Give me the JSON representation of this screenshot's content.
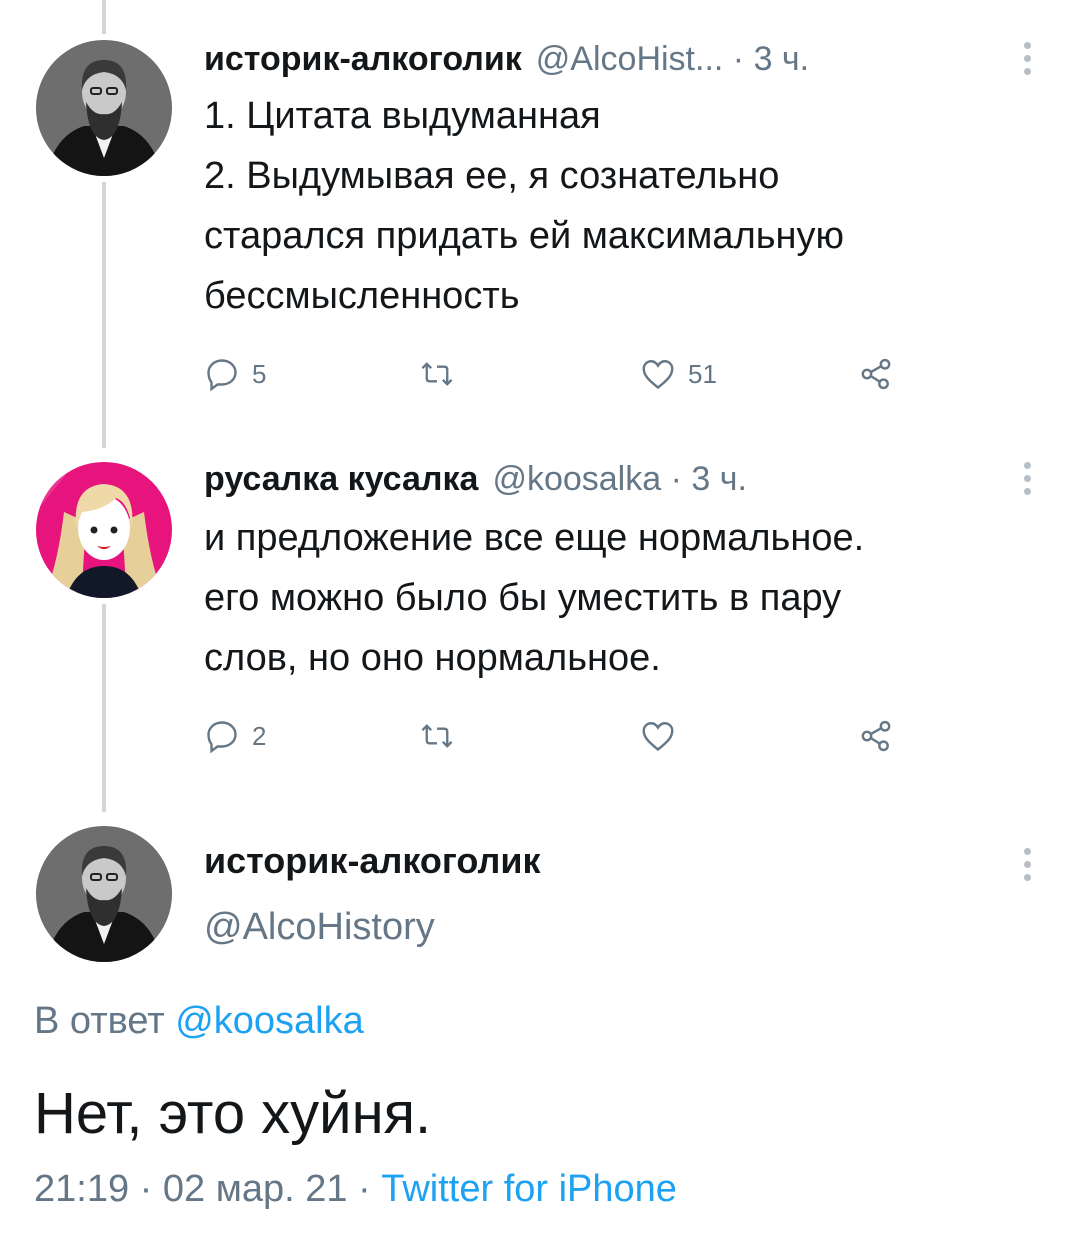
{
  "tweets": [
    {
      "name": "историк-алкоголик",
      "handle": "@AlcoHist...",
      "sep": " · ",
      "time": "3 ч.",
      "lines": [
        "1. Цитата выдуманная",
        "2. Выдумывая ее, я сознательно",
        "старался придать ей максимальную",
        "бессмысленность"
      ],
      "replies": "5",
      "retweets": "",
      "likes": "51"
    },
    {
      "name": "русалка кусалка",
      "handle": "@koosalka",
      "sep": " · ",
      "time": "3 ч.",
      "lines": [
        "и предложение все еще нормальное.",
        "его можно было бы уместить в пару",
        "слов, но оно нормальное."
      ],
      "replies": "2",
      "retweets": "",
      "likes": ""
    }
  ],
  "main": {
    "name": "историк-алкоголик",
    "handle": "@AlcoHistory",
    "reply_prefix": "В ответ ",
    "reply_mention": "@koosalka",
    "text": "Нет, это хуйня.",
    "timestamp": "21:19 · 02 мар. 21 · ",
    "client": "Twitter for iPhone"
  },
  "colors": {
    "text": "#14171a",
    "secondary": "#657786",
    "link": "#1da1f2",
    "thread_line": "#d0d5da",
    "avatar2_bg": "#e8147e"
  },
  "icons": [
    "reply-icon",
    "retweet-icon",
    "like-icon",
    "share-icon",
    "more-icon"
  ]
}
